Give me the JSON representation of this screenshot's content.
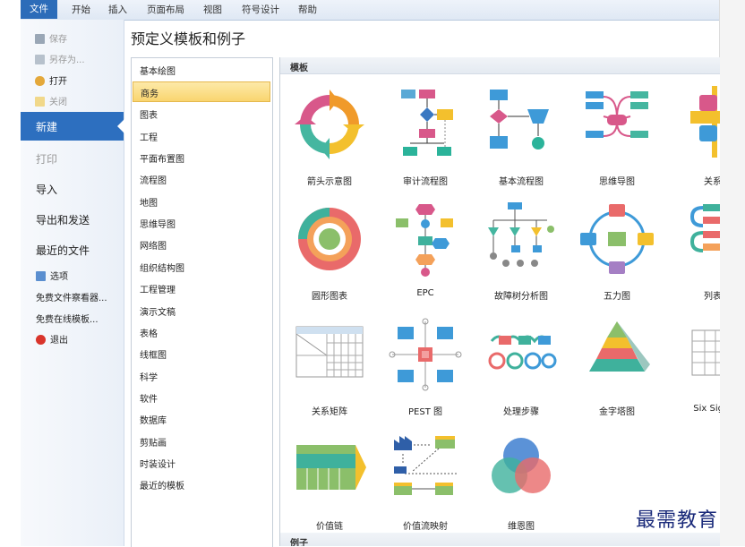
{
  "ribbon": {
    "tabs": [
      "文件",
      "开始",
      "插入",
      "页面布局",
      "视图",
      "符号设计",
      "帮助"
    ]
  },
  "menu": {
    "small_items": [
      {
        "label": "保存",
        "icon": "save-icon",
        "enabled": false
      },
      {
        "label": "另存为...",
        "icon": "save-as-icon",
        "enabled": false
      },
      {
        "label": "打开",
        "icon": "open-icon",
        "enabled": true
      },
      {
        "label": "关闭",
        "icon": "close-file-icon",
        "enabled": false
      }
    ],
    "selected": "新建",
    "big_items": [
      {
        "label": "打印",
        "enabled": false
      },
      {
        "label": "导入",
        "enabled": true
      },
      {
        "label": "导出和发送",
        "enabled": true
      },
      {
        "label": "最近的文件",
        "enabled": true
      }
    ],
    "links": [
      {
        "label": "选项",
        "icon": "options-icon"
      },
      {
        "label": "免费文件察看器...",
        "icon": ""
      },
      {
        "label": "免费在线模板...",
        "icon": ""
      },
      {
        "label": "退出",
        "icon": "exit-icon"
      }
    ]
  },
  "main": {
    "title": "预定义模板和例子",
    "categories": [
      "基本绘图",
      "商务",
      "图表",
      "工程",
      "平面布置图",
      "流程图",
      "地图",
      "思维导图",
      "网络图",
      "组织结构图",
      "工程管理",
      "演示文稿",
      "表格",
      "线框图",
      "科学",
      "软件",
      "数据库",
      "剪贴画",
      "时装设计",
      "最近的模板"
    ],
    "selected_category": "商务",
    "templates_header": "模板",
    "examples_header": "例子",
    "templates": [
      "箭头示意图",
      "审计流程图",
      "基本流程图",
      "思维导图",
      "关系",
      "圆形图表",
      "EPC",
      "故障树分析图",
      "五力图",
      "列表",
      "关系矩阵",
      "PEST 图",
      "处理步骤",
      "金字塔图",
      "Six Sigm",
      "价值链",
      "价值流映射",
      "维恩图"
    ]
  },
  "watermark": "最需教育",
  "colors": {
    "accent": "#2d6fbf",
    "selection": "#f9d56f"
  }
}
